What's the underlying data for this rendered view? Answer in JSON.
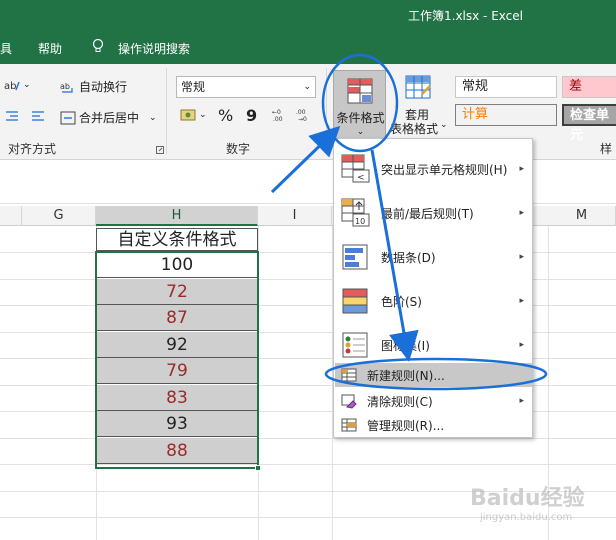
{
  "window": {
    "title": "工作簿1.xlsx  -  Excel"
  },
  "menu": {
    "tools": "具",
    "help": "帮助",
    "search": "操作说明搜索"
  },
  "ribbon": {
    "wrap_text": "自动换行",
    "merge_center": "合并后居中",
    "align_group": "对齐方式",
    "number_format": "常规",
    "number_group": "数字",
    "percent": "%",
    "comma": "9",
    "cond_format": "条件格式",
    "table_format_l1": "套用",
    "table_format_l2": "表格格式",
    "styles": {
      "normal": "常规",
      "bad": "差",
      "calc": "计算",
      "check": "检查单元",
      "group": "样"
    }
  },
  "grid": {
    "columns": [
      "G",
      "H",
      "I",
      "M"
    ],
    "header_cell": "自定义条件格式",
    "values": [
      {
        "v": "100",
        "color": "#222222",
        "shaded": false
      },
      {
        "v": "72",
        "color": "#9c2a2a",
        "shaded": true
      },
      {
        "v": "87",
        "color": "#9c2a2a",
        "shaded": true
      },
      {
        "v": "92",
        "color": "#222222",
        "shaded": true
      },
      {
        "v": "79",
        "color": "#9c2a2a",
        "shaded": true
      },
      {
        "v": "83",
        "color": "#9c2a2a",
        "shaded": true
      },
      {
        "v": "93",
        "color": "#222222",
        "shaded": true
      },
      {
        "v": "88",
        "color": "#9c2a2a",
        "shaded": true
      }
    ]
  },
  "dropdown": {
    "highlight_rules": "突出显示单元格规则(H)",
    "top_bottom": "最前/最后规则(T)",
    "data_bars": "数据条(D)",
    "color_scales": "色阶(S)",
    "icon_sets": "图标集(I)",
    "new_rule": "新建规则(N)...",
    "clear_rules": "清除规则(C)",
    "manage_rules": "管理规则(R)..."
  },
  "watermark": {
    "text": "Baidu经验",
    "sub": "jingyan.baidu.com"
  },
  "colors": {
    "excel_green": "#217346",
    "annotation_blue": "#1a6fd8",
    "bad_red": "#9c0006",
    "calc_orange": "#fa7d00"
  }
}
